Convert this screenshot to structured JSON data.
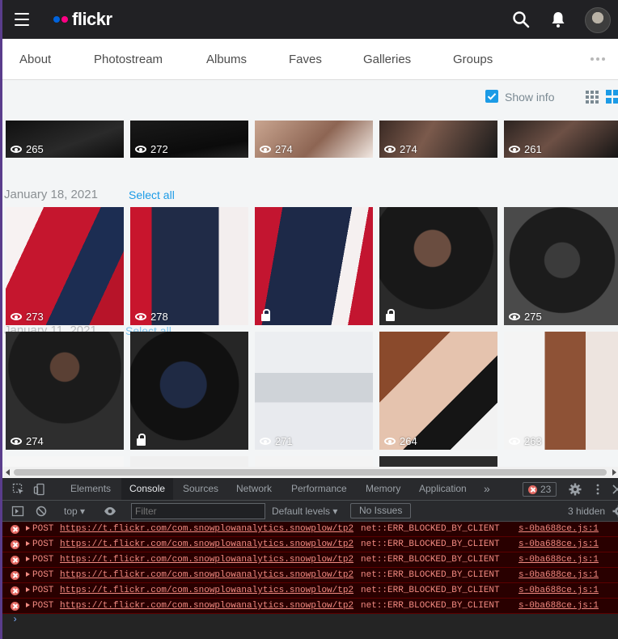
{
  "app": {
    "logo_text": "flickr",
    "brand_colors": {
      "blue": "#0063dc",
      "pink": "#ff0084"
    }
  },
  "nav": {
    "items": [
      "About",
      "Photostream",
      "Albums",
      "Faves",
      "Galleries",
      "Groups"
    ]
  },
  "toolbar": {
    "show_info_label": "Show info",
    "show_info_checked": true,
    "accent": "#1c9be6"
  },
  "groups": [
    {
      "date": "",
      "select_label": "",
      "photos": [
        {
          "views": "265"
        },
        {
          "views": "272"
        },
        {
          "views": "274"
        },
        {
          "views": "274"
        },
        {
          "views": "261"
        }
      ]
    },
    {
      "date": "January 18, 2021",
      "select_label": "Select all",
      "photos": [
        {
          "views": "273"
        },
        {
          "views": "278"
        },
        {
          "views": "",
          "private": true
        },
        {
          "views": "",
          "private": true
        },
        {
          "views": "275"
        }
      ]
    },
    {
      "date": "January 11, 2021",
      "select_label": "Select all",
      "photos": [
        {
          "views": "274"
        },
        {
          "views": "",
          "private": true
        },
        {
          "views": "271"
        },
        {
          "views": "264"
        },
        {
          "views": "263"
        }
      ]
    }
  ],
  "devtools": {
    "tabs": [
      "Elements",
      "Console",
      "Sources",
      "Network",
      "Performance",
      "Memory",
      "Application"
    ],
    "active_tab": "Console",
    "error_count": "23",
    "context": "top",
    "filter_placeholder": "Filter",
    "levels": "Default levels",
    "issues": "No Issues",
    "hidden": "3 hidden",
    "logs": [
      {
        "method": "POST",
        "url": "https://t.flickr.com/com.snowplowanalytics.snowplow/tp2",
        "msg": "net::ERR_BLOCKED_BY_CLIENT",
        "src": "s-0ba688ce.js:1"
      },
      {
        "method": "POST",
        "url": "https://t.flickr.com/com.snowplowanalytics.snowplow/tp2",
        "msg": "net::ERR_BLOCKED_BY_CLIENT",
        "src": "s-0ba688ce.js:1"
      },
      {
        "method": "POST",
        "url": "https://t.flickr.com/com.snowplowanalytics.snowplow/tp2",
        "msg": "net::ERR_BLOCKED_BY_CLIENT",
        "src": "s-0ba688ce.js:1"
      },
      {
        "method": "POST",
        "url": "https://t.flickr.com/com.snowplowanalytics.snowplow/tp2",
        "msg": "net::ERR_BLOCKED_BY_CLIENT",
        "src": "s-0ba688ce.js:1"
      },
      {
        "method": "POST",
        "url": "https://t.flickr.com/com.snowplowanalytics.snowplow/tp2",
        "msg": "net::ERR_BLOCKED_BY_CLIENT",
        "src": "s-0ba688ce.js:1"
      },
      {
        "method": "POST",
        "url": "https://t.flickr.com/com.snowplowanalytics.snowplow/tp2",
        "msg": "net::ERR_BLOCKED_BY_CLIENT",
        "src": "s-0ba688ce.js:1"
      }
    ]
  }
}
